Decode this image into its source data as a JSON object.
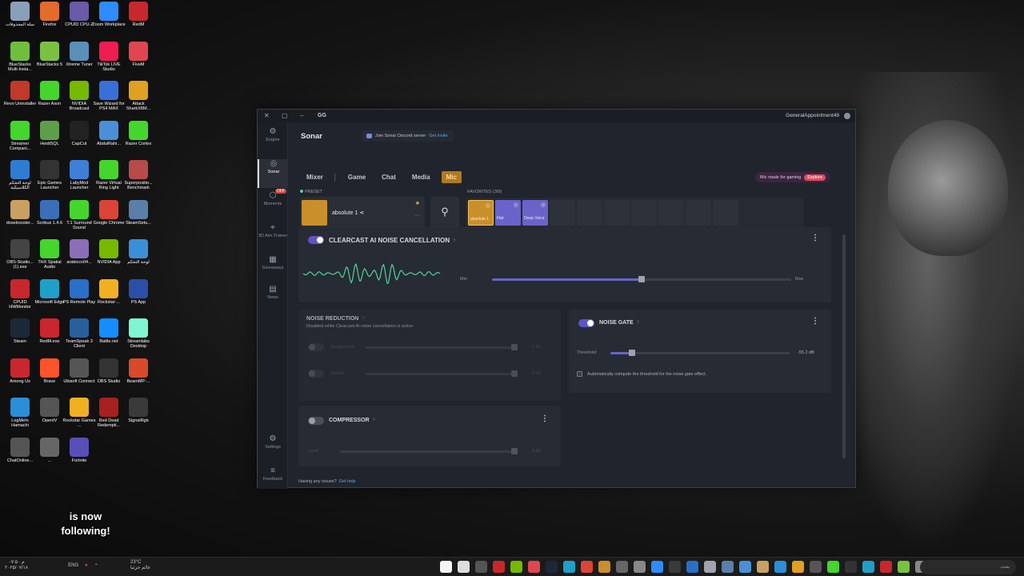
{
  "desktop": {
    "icons": [
      {
        "label": "سلة المحذوفات",
        "color": "#8aa0b8"
      },
      {
        "label": "Firefox",
        "color": "#e36b2c"
      },
      {
        "label": "CPUID CPU-Z",
        "color": "#6a5aa8"
      },
      {
        "label": "Zoom Workplace",
        "color": "#2d8cff"
      },
      {
        "label": "RedM",
        "color": "#c8272d"
      },
      {
        "label": "BlueStacks Multi-Insta...",
        "color": "#6fbf3c"
      },
      {
        "label": "BlueStacks 5",
        "color": "#7ac142"
      },
      {
        "label": "Xtreme Tuner",
        "color": "#5a8fb8"
      },
      {
        "label": "TikTok LIVE Studio",
        "color": "#ee1d52"
      },
      {
        "label": "FiveM",
        "color": "#e0464f"
      },
      {
        "label": "Revo Uninstaller",
        "color": "#c0392b"
      },
      {
        "label": "Razer Axon",
        "color": "#44d62c"
      },
      {
        "label": "NVIDIA Broadcast",
        "color": "#76b900"
      },
      {
        "label": "Save Wizard for PS4 MAX",
        "color": "#3b6fd8"
      },
      {
        "label": "Attack SharkX8M...",
        "color": "#e0a020"
      },
      {
        "label": "Streamer Compani...",
        "color": "#44d62c"
      },
      {
        "label": "HeidiSQL",
        "color": "#5e9e4a"
      },
      {
        "label": "CapCut",
        "color": "#222222"
      },
      {
        "label": "AbdulRahi...",
        "color": "#4a8fd8"
      },
      {
        "label": "Razer Cortex",
        "color": "#44d62c"
      },
      {
        "label": "لوحة التحكم الكلاسيكية",
        "color": "#2d7dd2"
      },
      {
        "label": "Epic Games Launcher",
        "color": "#333333"
      },
      {
        "label": "LabyMod Launcher",
        "color": "#3f7fd8"
      },
      {
        "label": "Razer Virtual Ring Light",
        "color": "#44d62c"
      },
      {
        "label": "Superpositio... Benchmark",
        "color": "#b84a4a"
      },
      {
        "label": "dosebooster...",
        "color": "#c8a060"
      },
      {
        "label": "Scribus 1.4.6",
        "color": "#3a6fb8"
      },
      {
        "label": "T.1 Surround Sound",
        "color": "#44d62c"
      },
      {
        "label": "Google Chrome",
        "color": "#db4437"
      },
      {
        "label": "SteamSetu...",
        "color": "#5a7fa8"
      },
      {
        "label": "OBS-Studio... (1).exe",
        "color": "#444444"
      },
      {
        "label": "THX Spatial Audio",
        "color": "#44d62c"
      },
      {
        "label": "arabiccv04...",
        "color": "#8a6fb8"
      },
      {
        "label": "NVIDIA App",
        "color": "#76b900"
      },
      {
        "label": "لوحة التحكم",
        "color": "#3b8fd8"
      },
      {
        "label": "CPUID HWMonitor",
        "color": "#c8272d"
      },
      {
        "label": "Microsoft Edge",
        "color": "#1ea0c8"
      },
      {
        "label": "PS Remote Play",
        "color": "#2a6fc8"
      },
      {
        "label": "Rockstar-...",
        "color": "#f0b020"
      },
      {
        "label": "PS App",
        "color": "#2a4fa8"
      },
      {
        "label": "Steam",
        "color": "#1b2838"
      },
      {
        "label": "RedM.exe",
        "color": "#c8272d"
      },
      {
        "label": "TeamSpeak 3 Client",
        "color": "#2a5f9e"
      },
      {
        "label": "Battle.net",
        "color": "#148eff"
      },
      {
        "label": "Streamlabs Desktop",
        "color": "#80f5d2"
      },
      {
        "label": "Among Us",
        "color": "#c8272d"
      },
      {
        "label": "Brave",
        "color": "#fb542b"
      },
      {
        "label": "Ubisoft Connect",
        "color": "#555555"
      },
      {
        "label": "OBS Studio",
        "color": "#333333"
      },
      {
        "label": "BeamMP-...",
        "color": "#d84a2a"
      },
      {
        "label": "LogMeIn Hamachi",
        "color": "#2a8fd8"
      },
      {
        "label": "OpenIV",
        "color": "#555555"
      },
      {
        "label": "Rockstar Games ...",
        "color": "#f0b020"
      },
      {
        "label": "Red Dead Redempti...",
        "color": "#a82020"
      },
      {
        "label": "SignalRgb",
        "color": "#3a3a3a"
      },
      {
        "label": "ChatOnline...",
        "color": "#555555"
      },
      {
        "label": "...",
        "color": "#666666"
      },
      {
        "label": "Fortnite",
        "color": "#5a4fb8"
      }
    ]
  },
  "caption": {
    "line1": "is now",
    "line2": "following!"
  },
  "taskbar": {
    "time": "۰۷:۵۰ م",
    "date": "۲۰۲۵/۰۷/۱۸",
    "lang": "ENG",
    "temp": "23°C",
    "weather": "غائم جزئيا",
    "search_placeholder": "بحث",
    "icon_colors": [
      "#f5f5f5",
      "#ddd",
      "#555",
      "#c8272d",
      "#76b900",
      "#e0464f",
      "#1b2838",
      "#1ea0c8",
      "#db4437",
      "#c98f2a",
      "#666",
      "#888",
      "#2d8cff",
      "#3a3a3a",
      "#2a6fc8",
      "#9ea3ad",
      "#5a7fa8",
      "#4a8fd8",
      "#c8a060",
      "#2a8fd8",
      "#e0a020",
      "#555",
      "#44d62c",
      "#333",
      "#1ea0c8",
      "#c8272d",
      "#7ac142",
      "#888"
    ]
  },
  "window": {
    "title": "GG",
    "username": "GeneralAppointment49"
  },
  "nav": [
    {
      "label": "Engine",
      "icon": "⚙"
    },
    {
      "label": "Sonar",
      "icon": "◎"
    },
    {
      "label": "Moments",
      "icon": "⬡",
      "badge": "OFF"
    },
    {
      "label": "3D Aim Trainer",
      "icon": "⌖"
    },
    {
      "label": "Giveaways",
      "icon": "▦"
    },
    {
      "label": "News",
      "icon": "▤"
    },
    {
      "label": "Settings",
      "icon": "⚙"
    },
    {
      "label": "Feedback",
      "icon": "≡"
    }
  ],
  "sonar": {
    "title": "Sonar",
    "discord_text": "Join Sonar Discord server",
    "discord_link": "Get invite",
    "tabs": [
      "Mixer",
      "Game",
      "Chat",
      "Media",
      "Mic"
    ],
    "explore_text": "Mic made for gaming",
    "explore_link": "Explore",
    "preset_label": "PRESET",
    "preset_name": "absolute 1",
    "favorites_label": "FAVORITES (3/9)",
    "favorites": [
      "absolute 1",
      "Flat",
      "Deep Voice",
      "",
      "",
      "",
      "",
      "",
      "",
      ""
    ],
    "clearcast": {
      "title": "CLEARCAST AI NOISE CANCELLATION",
      "min": "Min",
      "max": "Max",
      "level": 0.5
    },
    "noise_reduction": {
      "title": "NOISE REDUCTION",
      "subtitle": "Disabled while Clearcast AI noise cancellation is active",
      "rows": [
        {
          "label": "Background",
          "value": "1.00",
          "level": 1
        },
        {
          "label": "Impact",
          "value": "1.00",
          "level": 1
        }
      ]
    },
    "noise_gate": {
      "title": "NOISE GATE",
      "threshold_label": "Threshold",
      "threshold_value": "-55.2 dB",
      "threshold_level": 0.12,
      "auto_label": "Automatically compute the threshold for the noise gate effect."
    },
    "compressor": {
      "title": "COMPRESSOR",
      "row_label": "Level",
      "row_value": "0.00",
      "level": 1
    },
    "help_text": "Having any issues?",
    "help_link": "Get help"
  },
  "colors": {
    "accent": "#6a63c9",
    "mic_tab": "#b07a1e",
    "wave": "#4fd3a0"
  }
}
